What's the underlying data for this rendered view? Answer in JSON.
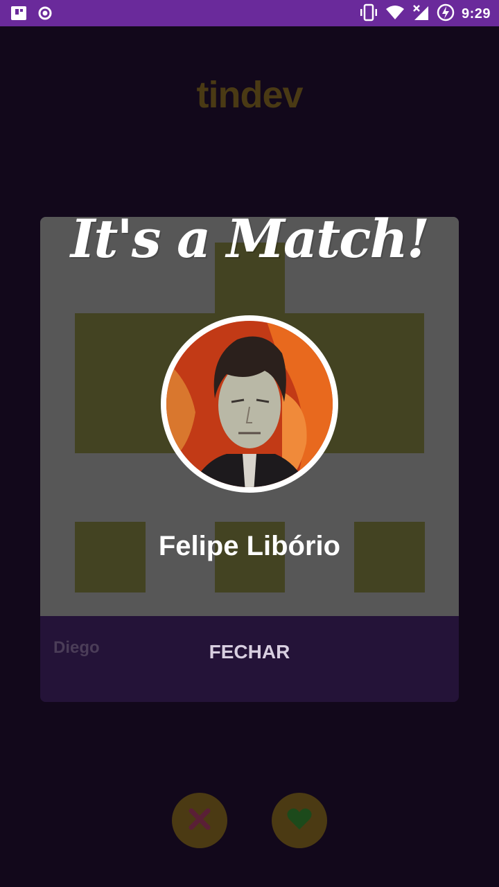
{
  "status_bar": {
    "time": "9:29",
    "icons": [
      "app-notification-icon",
      "circle-notification-icon",
      "vibrate-icon",
      "wifi-icon",
      "no-signal-icon",
      "battery-charging-icon"
    ]
  },
  "header": {
    "logo_text": "tindev"
  },
  "card": {
    "name": "Diego"
  },
  "match": {
    "title": "It's a Match!",
    "name": "Felipe Libório",
    "close_label": "FECHAR"
  },
  "actions": {
    "dislike_icon": "close-icon",
    "like_icon": "heart-icon"
  },
  "colors": {
    "status_bar": "#6a2a9b",
    "background": "#12081b",
    "dislike_button": "#4b3a13",
    "dislike_glyph": "#5a1f36",
    "like_glyph": "#1c4a1b"
  }
}
